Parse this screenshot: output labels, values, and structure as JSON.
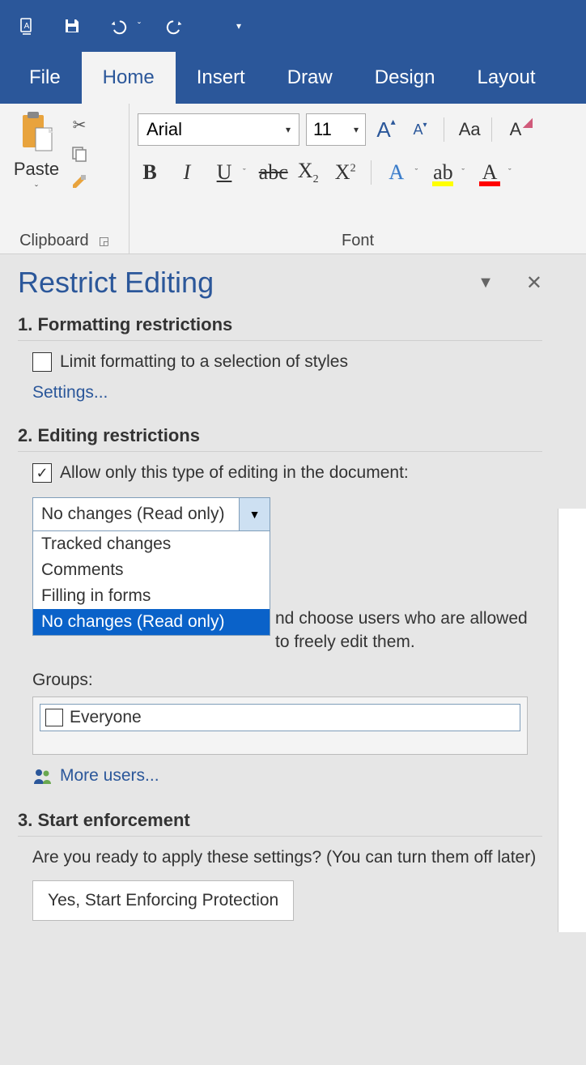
{
  "qat": {
    "undo_caret": "ˇ",
    "redo_caret": "",
    "customize_caret": "▾"
  },
  "tabs": {
    "file": "File",
    "home": "Home",
    "insert": "Insert",
    "draw": "Draw",
    "design": "Design",
    "layout": "Layout"
  },
  "ribbon": {
    "clipboard": {
      "paste": "Paste",
      "label": "Clipboard"
    },
    "font": {
      "name": "Arial",
      "size": "11",
      "caseLabel": "Aa",
      "label": "Font"
    }
  },
  "pane": {
    "title": "Restrict Editing",
    "section1": "1. Formatting restrictions",
    "limit_formatting": "Limit formatting to a selection of styles",
    "settings_link": "Settings...",
    "section2": "2. Editing restrictions",
    "allow_only": "Allow only this type of editing in the document:",
    "combo_value": "No changes (Read only)",
    "combo_options": [
      "Tracked changes",
      "Comments",
      "Filling in forms",
      "No changes (Read only)"
    ],
    "exceptions_partial": "nd choose users who are allowed to freely edit them.",
    "groups_label": "Groups:",
    "group_everyone": "Everyone",
    "more_users": "More users...",
    "section3": "3. Start enforcement",
    "enforce_q": "Are you ready to apply these settings? (You can turn them off later)",
    "enforce_btn": "Yes, Start Enforcing Protection"
  }
}
